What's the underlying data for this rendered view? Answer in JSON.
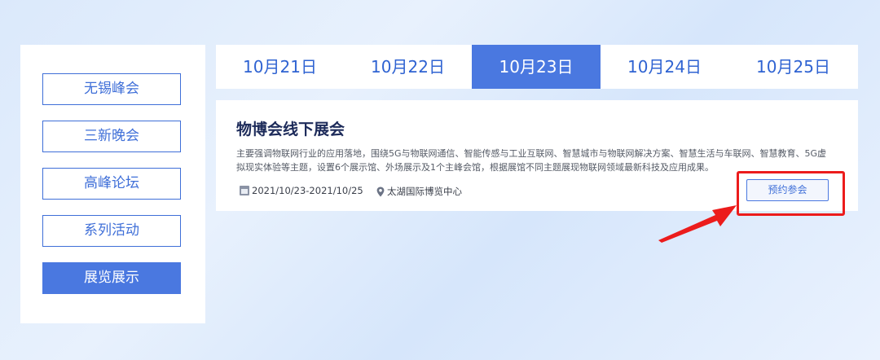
{
  "sidebar": {
    "items": [
      {
        "label": "无锡峰会",
        "active": false
      },
      {
        "label": "三新晚会",
        "active": false
      },
      {
        "label": "高峰论坛",
        "active": false
      },
      {
        "label": "系列活动",
        "active": false
      },
      {
        "label": "展览展示",
        "active": true
      }
    ]
  },
  "tabs": [
    {
      "label": "10月21日",
      "active": false
    },
    {
      "label": "10月22日",
      "active": false
    },
    {
      "label": "10月23日",
      "active": true
    },
    {
      "label": "10月24日",
      "active": false
    },
    {
      "label": "10月25日",
      "active": false
    }
  ],
  "event": {
    "title": "物博会线下展会",
    "description": "主要强调物联网行业的应用落地，围绕5G与物联网通信、智能传感与工业互联网、智慧城市与物联网解决方案、智慧生活与车联网、智慧教育、5G虚拟现实体验等主题，设置6个展示馆、外场展示及1个主峰会馆，根据展馆不同主题展现物联网领域最新科技及应用成果。",
    "date": "2021/10/23-2021/10/25",
    "location": "太湖国际博览中心",
    "book_label": "预约参会"
  },
  "colors": {
    "accent": "#4a78e0",
    "annotation": "#ec1c1c"
  }
}
